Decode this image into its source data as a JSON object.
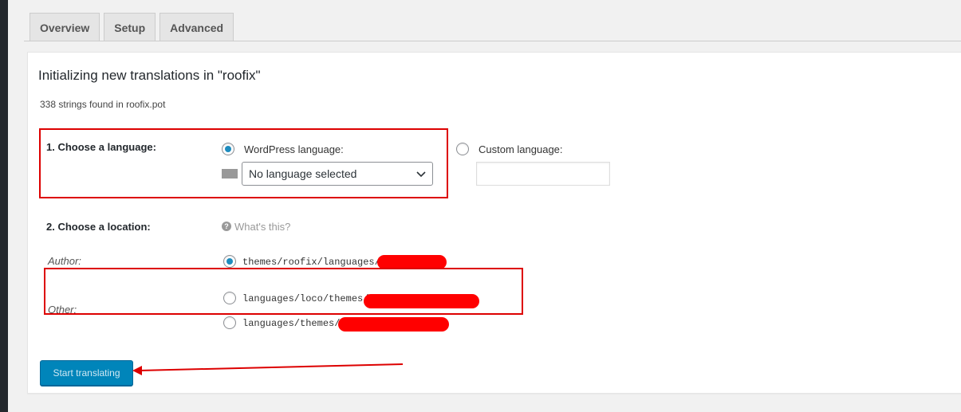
{
  "tabs": [
    {
      "label": "Overview"
    },
    {
      "label": "Setup"
    },
    {
      "label": "Advanced"
    }
  ],
  "page": {
    "title": "Initializing new translations in \"roofix\"",
    "strings_found": "338 strings found in roofix.pot"
  },
  "language": {
    "heading": "1. Choose a language:",
    "wordpress_option": "WordPress language:",
    "wordpress_selected": true,
    "select_value": "No language selected",
    "custom_option": "Custom language:",
    "custom_value": ""
  },
  "location": {
    "heading": "2. Choose a location:",
    "help_text": "What's this?",
    "author_label": "Author:",
    "other_label": "Other:",
    "options": [
      {
        "path": "themes/roofix/languages/",
        "checked": true
      },
      {
        "path": "languages/loco/themes/",
        "checked": false
      },
      {
        "path": "languages/themes/",
        "checked": false
      }
    ]
  },
  "actions": {
    "start_label": "Start translating"
  },
  "colors": {
    "accent": "#0085ba",
    "annotation": "#dd0000",
    "redaction": "#ff0000"
  }
}
